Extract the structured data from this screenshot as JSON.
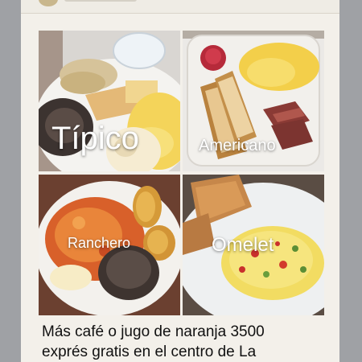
{
  "tiles": [
    {
      "label": "Típico"
    },
    {
      "label": "Americano"
    },
    {
      "label": "Ranchero"
    },
    {
      "label": "Omelet"
    }
  ],
  "caption": {
    "line1": "Más café o jugo de naranja 3500",
    "line2": "exprés gratis en el centro de La"
  }
}
